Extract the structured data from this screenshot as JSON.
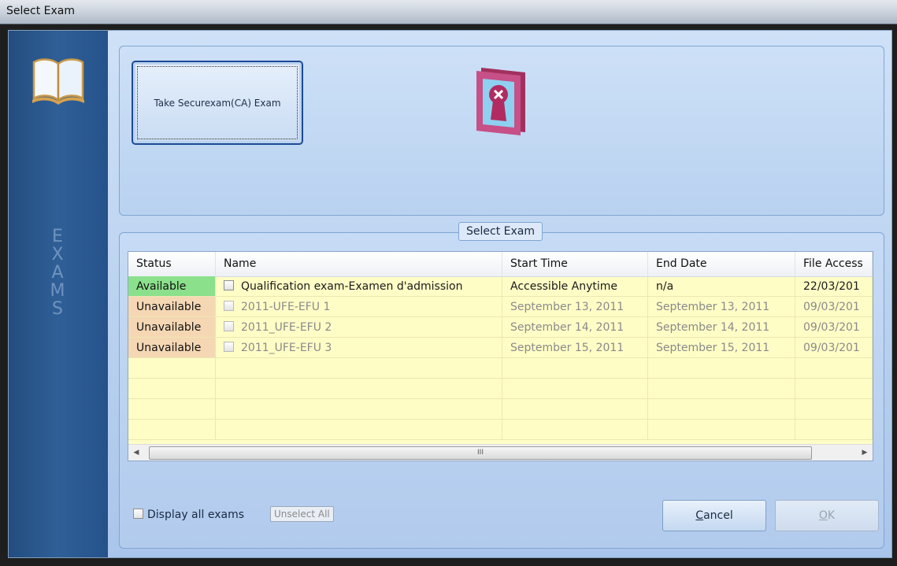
{
  "window": {
    "title": "Select Exam"
  },
  "sidebar": {
    "letters": [
      "E",
      "X",
      "A",
      "M",
      "S"
    ]
  },
  "top": {
    "exam_button_label": "Take Securexam(CA) Exam"
  },
  "group": {
    "label": "Select Exam"
  },
  "grid": {
    "columns": [
      "Status",
      "Name",
      "Start Time",
      "End Date",
      "File Access"
    ],
    "rows": [
      {
        "status": "Available",
        "name": "Qualification exam-Examen d'admission",
        "start": "Accessible Anytime",
        "end": "n/a",
        "access": "22/03/201",
        "enabled": true
      },
      {
        "status": "Unavailable",
        "name": "2011-UFE-EFU 1",
        "start": "September 13, 2011",
        "end": "September 13, 2011",
        "access": "09/03/201",
        "enabled": false
      },
      {
        "status": "Unavailable",
        "name": "2011_UFE-EFU 2",
        "start": "September 14, 2011",
        "end": "September 14, 2011",
        "access": "09/03/201",
        "enabled": false
      },
      {
        "status": "Unavailable",
        "name": "2011_UFE-EFU 3",
        "start": "September 15, 2011",
        "end": "September 15, 2011",
        "access": "09/03/201",
        "enabled": false
      }
    ],
    "scroll_grip": "III"
  },
  "footer": {
    "display_all_label": "Display all exams",
    "unselect_all_label": "Unselect All",
    "cancel_label_first": "C",
    "cancel_label_rest": "ancel",
    "ok_label_first": "O",
    "ok_label_rest": "K"
  },
  "colors": {
    "available": "#8be08b",
    "unavailable": "#f5d7b4",
    "grid_background": "#fffdc6",
    "sidebar": "#2f5f96"
  },
  "icons": {
    "sidebar": "open-book-icon",
    "top": "lock-icon"
  }
}
